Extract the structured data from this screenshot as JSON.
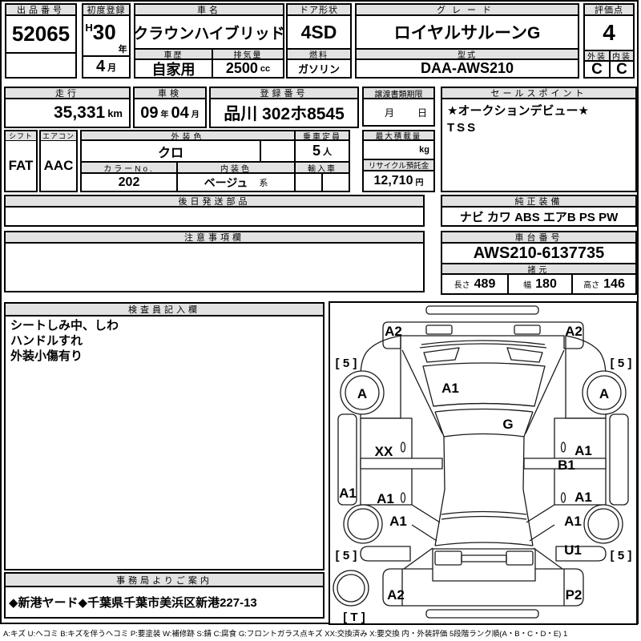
{
  "sheet": {
    "headers": {
      "lot_no": "出品番号",
      "first_registration": "初度登録",
      "car_name": "車名",
      "door_shape": "ドア形状",
      "grade": "グレード",
      "score": "評価点",
      "history": "車歴",
      "displacement": "排気量",
      "fuel": "燃料",
      "model_code": "型式",
      "exterior": "外装",
      "interior": "内装",
      "mileage": "走行",
      "inspection": "車検",
      "registration_no": "登録番号",
      "transfer_deadline": "譲渡書類期限",
      "sales_point": "セールスポイント",
      "shift": "シフト",
      "aircon": "エアコン",
      "exterior_color": "外装色",
      "capacity": "乗車定員",
      "max_load": "最大積載量",
      "color_no": "カラーNo.",
      "interior_color": "内装色",
      "import_car": "輸入車",
      "recycle_deposit": "リサイクル預託金",
      "later_parts": "後日発送部品",
      "oem_equipment": "純正装備",
      "cautions": "注意事項欄",
      "chassis_no": "車台番号",
      "specs": "諸元",
      "inspector_notes": "検査員記入欄",
      "office_notice": "事務局よりご案内",
      "length": "長さ",
      "width": "幅",
      "height": "高さ"
    },
    "values": {
      "lot_no": "52065",
      "era": "H",
      "reg_year": "30",
      "year_unit": "年",
      "reg_month": "4",
      "month_unit": "月",
      "car_name": "クラウンハイブリッド",
      "door_shape": "4SD",
      "grade": "ロイヤルサルーンG",
      "history": "自家用",
      "displacement": "2500",
      "displacement_unit": "cc",
      "fuel": "ガソリン",
      "model_code": "DAA-AWS210",
      "score": "4",
      "exterior_score": "C",
      "interior_score": "C",
      "mileage": "35,331",
      "mileage_unit": "km",
      "inspection_year": "09",
      "inspection_month": "04",
      "registration_no": "品川 302ホ8545",
      "transfer_month": "月",
      "transfer_day": "日",
      "shift": "FAT",
      "aircon": "AAC",
      "exterior_color": "クロ",
      "capacity": "5",
      "capacity_unit": "人",
      "max_load_unit": "kg",
      "color_no": "202",
      "interior_color": "ベージュ",
      "interior_color_suffix": "系",
      "recycle_deposit": "12,710",
      "yen_unit": "円",
      "oem_equipment": "ナビ カワ ABS エアB PS PW",
      "chassis_no": "AWS210-6137735",
      "length": "489",
      "width": "180",
      "height": "146"
    },
    "sales_points": [
      "★オークションデビュー★",
      "TSS"
    ],
    "inspector_notes": [
      "シートしみ中、しわ",
      "ハンドルすれ",
      "外装小傷有り"
    ],
    "office_notice": "◆新港ヤード◆千葉県千葉市美浜区新港227-13",
    "legend": "A:キズ U:ヘコミ B:キズを伴うヘコミ P:要塗装 W:補修跡 S:錆 C:腐食 G:フロントガラス点キズ XX:交換済み X:要交換  内・外装評価 5段階ランク順(A・B・C・D・E) 1"
  },
  "diagram": {
    "labels": {
      "front_bumper_left": "A2",
      "front_bumper_right": "A2",
      "tire_front_left": "[ 5 ]",
      "tire_front_right": "[ 5 ]",
      "wheel_front_left": "A",
      "wheel_front_right": "A",
      "hood": "A1",
      "windshield": "G",
      "fender_left": "XX",
      "fender_right": "A1",
      "pillar_right": "B1",
      "rocker_left": "A1",
      "door_left": "A1",
      "door_right": "A1",
      "quarter_left": "A1",
      "quarter_right": "A1",
      "rear_quarter_right": "U1",
      "tire_rear_left": "[ 5 ]",
      "tire_rear_right": "[ 5 ]",
      "rear_bumper_left": "A2",
      "rear_bumper_right": "P2",
      "spare_tire": "[ T ]"
    }
  }
}
